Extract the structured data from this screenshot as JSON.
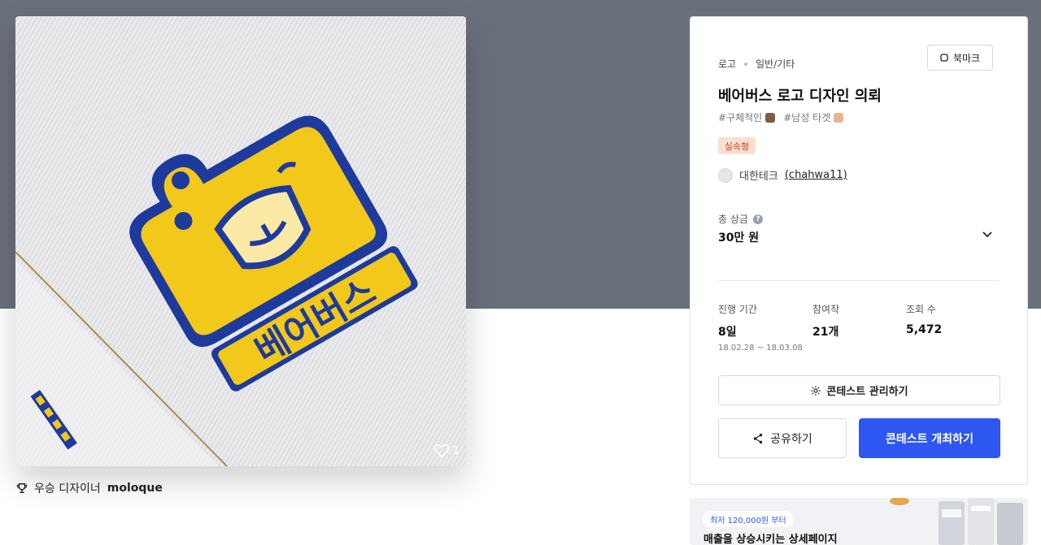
{
  "artwork": {
    "logo_text": "베어버스",
    "like_count": "1"
  },
  "winner": {
    "prefix": "우승 디자이너",
    "name": "moloque"
  },
  "panel": {
    "breadcrumb": [
      "로고",
      "일반/기타"
    ],
    "bookmark_label": "북마크",
    "title": "베어버스 로고 디자인 의뢰",
    "tags": [
      "#구체적인",
      "#남성 타겟"
    ],
    "badge": "실속형",
    "host_name": "대한테크",
    "host_handle": "(chahwa11)",
    "prize_label": "총 상금",
    "prize_value": "30만 원",
    "stats": [
      {
        "label": "진행 기간",
        "value": "8일",
        "sub": "18.02.28 ~ 18.03.08"
      },
      {
        "label": "참여작",
        "value": "21개"
      },
      {
        "label": "조회 수",
        "value": "5,472"
      }
    ],
    "manage_label": "콘테스트 관리하기",
    "share_label": "공유하기",
    "host_contest_label": "콘테스트 개최하기"
  },
  "ad": {
    "pill": "최저 120,000원 부터",
    "title": "매출을 상승시키는 상세페이지"
  },
  "colors": {
    "hero_bg": "#6a6f7c",
    "primary": "#2d57f0",
    "logo_yellow": "#f2c81a",
    "logo_blue": "#1e3a9c",
    "badge_bg": "#f8dfd2",
    "badge_text": "#c24a1b"
  }
}
